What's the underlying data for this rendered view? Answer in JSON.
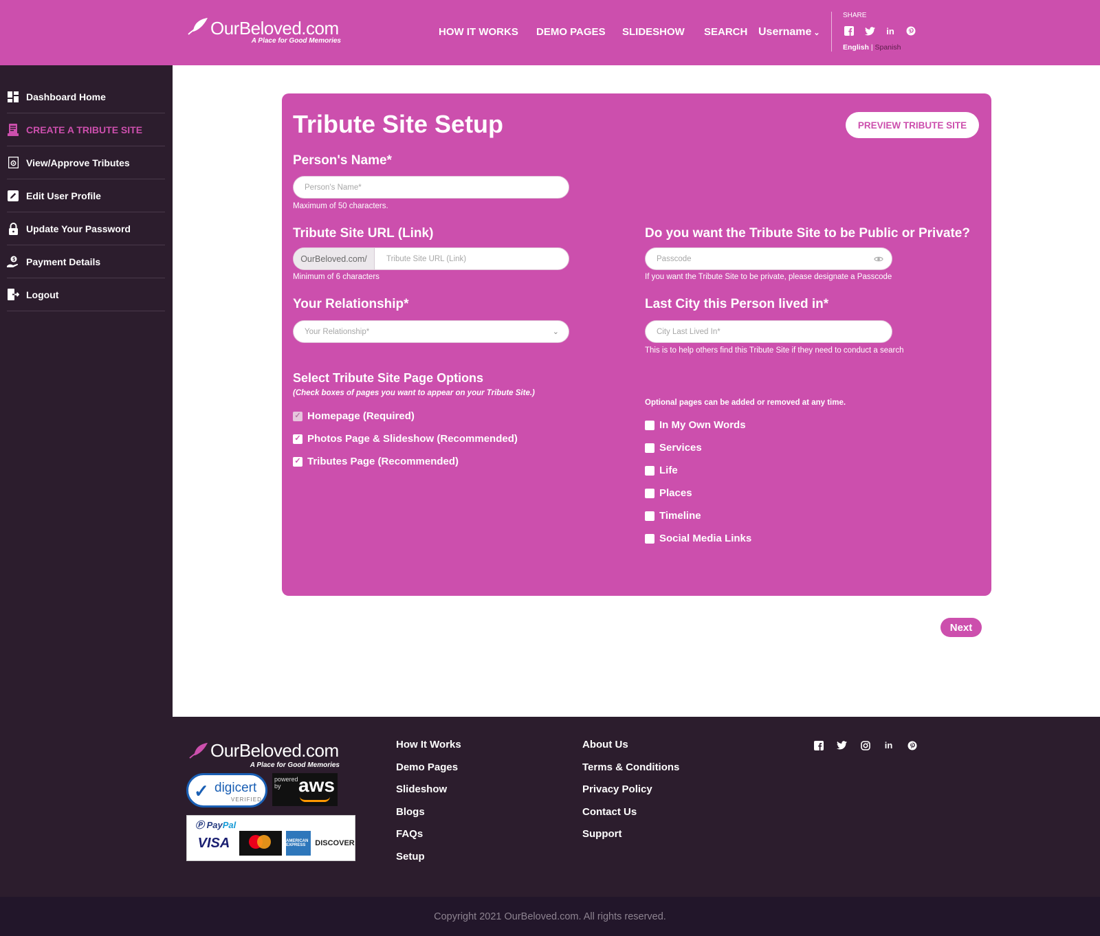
{
  "header": {
    "brand_name": "OurBeloved.com",
    "tagline": "A Place for Good Memories",
    "nav": [
      "HOW IT WORKS",
      "DEMO PAGES",
      "SLIDESHOW",
      "SEARCH"
    ],
    "username": "Username",
    "share_label": "SHARE",
    "share_icons": [
      "facebook-icon",
      "twitter-icon",
      "linkedin-icon",
      "pinterest-icon"
    ],
    "lang_english": "English",
    "lang_sep": " | ",
    "lang_spanish": "Spanish"
  },
  "sidebar": {
    "items": [
      {
        "label": "Dashboard Home",
        "icon": "dashboard-icon"
      },
      {
        "label": "CREATE A TRIBUTE SITE",
        "icon": "create-site-icon",
        "active": true
      },
      {
        "label": "View/Approve Tributes",
        "icon": "view-tributes-icon"
      },
      {
        "label": "Edit User Profile",
        "icon": "edit-icon"
      },
      {
        "label": "Update Your Password",
        "icon": "lock-icon"
      },
      {
        "label": "Payment Details",
        "icon": "payment-icon"
      },
      {
        "label": "Logout",
        "icon": "logout-icon"
      }
    ]
  },
  "form": {
    "title": "Tribute Site Setup",
    "preview_button": "PREVIEW TRIBUTE SITE",
    "name_label": "Person's Name*",
    "name_placeholder": "Person's Name*",
    "name_hint": "Maximum of 50 characters.",
    "url_label": "Tribute Site URL (Link)",
    "url_prefix": "OurBeloved.com/",
    "url_placeholder": "Tribute Site URL (Link)",
    "url_hint": "Minimum of 6 characters",
    "privacy_label": "Do you want the Tribute Site to be Public or Private?",
    "passcode_placeholder": "Passcode",
    "passcode_hint": "If you want the Tribute Site to be private, please designate a Passcode",
    "relationship_label": "Your Relationship*",
    "relationship_placeholder": "Your Relationship*",
    "city_label": "Last City this Person lived in*",
    "city_placeholder": "City Last Lived In*",
    "city_hint": "This is to help others find this Tribute Site if they need to conduct a search",
    "options_title": "Select Tribute Site Page Options",
    "options_sub": "(Check boxes of pages you want to appear on your Tribute Site.)",
    "optional_note": "Optional pages can be added or removed at any time.",
    "required_options": [
      {
        "label": "Homepage (Required)",
        "checked": true,
        "disabled": true
      },
      {
        "label": "Photos Page & Slideshow (Recommended)",
        "checked": true
      },
      {
        "label": "Tributes Page (Recommended)",
        "checked": true
      }
    ],
    "optional_options": [
      {
        "label": "In My Own Words",
        "checked": false
      },
      {
        "label": "Services",
        "checked": false
      },
      {
        "label": "Life",
        "checked": false
      },
      {
        "label": "Places",
        "checked": false
      },
      {
        "label": "Timeline",
        "checked": false
      },
      {
        "label": "Social Media Links",
        "checked": false
      }
    ],
    "next_button": "Next"
  },
  "footer": {
    "brand_name": "OurBeloved.com",
    "tagline": "A Place for Good Memories",
    "digicert": "digicert",
    "digicert_verified": "VERIFIED",
    "aws_powered": "powered by",
    "aws": "aws",
    "paypal_a": "Pay",
    "paypal_b": "Pal",
    "visa": "VISA",
    "amex": "AMERICAN EXPRESS",
    "discover": "DISCOVER",
    "col1": [
      "How It Works",
      "Demo Pages",
      "Slideshow",
      "Blogs",
      "FAQs",
      "Setup"
    ],
    "col2": [
      "About Us",
      "Terms & Conditions",
      "Privacy Policy",
      "Contact Us",
      "Support"
    ],
    "social_icons": [
      "facebook-icon",
      "twitter-icon",
      "instagram-icon",
      "linkedin-icon",
      "pinterest-icon"
    ],
    "copyright": "Copyright 2021 OurBeloved.com. All rights reserved."
  },
  "colors": {
    "brand": "#cc4fad",
    "dark": "#2c1d2d"
  }
}
